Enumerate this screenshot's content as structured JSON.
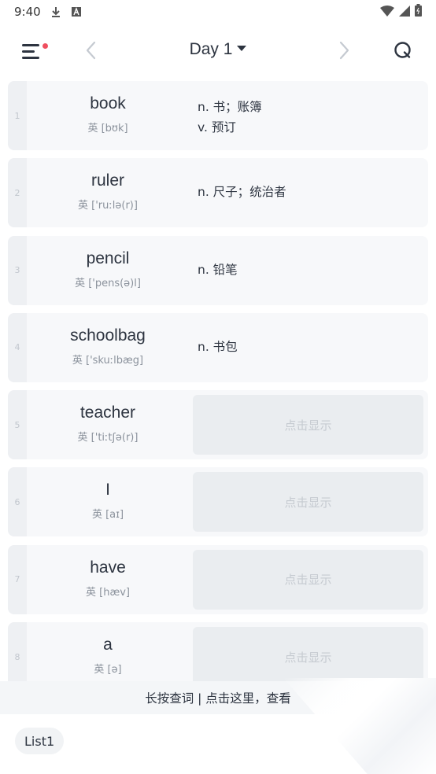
{
  "status_bar": {
    "time": "9:40"
  },
  "header": {
    "title": "Day 1"
  },
  "words": [
    {
      "index": "1",
      "word": "book",
      "phonetic": "英 [bʊk]",
      "meanings": [
        "n. 书；账簿",
        "v. 预订"
      ],
      "revealed": true
    },
    {
      "index": "2",
      "word": "ruler",
      "phonetic": "英 ['ruːlə(r)]",
      "meanings": [
        "n. 尺子；统治者"
      ],
      "revealed": true
    },
    {
      "index": "3",
      "word": "pencil",
      "phonetic": "英 ['pens(ə)l]",
      "meanings": [
        "n. 铅笔"
      ],
      "revealed": true
    },
    {
      "index": "4",
      "word": "schoolbag",
      "phonetic": "英 ['skuːlbæg]",
      "meanings": [
        "n. 书包"
      ],
      "revealed": true
    },
    {
      "index": "5",
      "word": "teacher",
      "phonetic": "英 ['tiːtʃə(r)]",
      "reveal_label": "点击显示",
      "revealed": false
    },
    {
      "index": "6",
      "word": "I",
      "phonetic": "英 [aɪ]",
      "reveal_label": "点击显示",
      "revealed": false
    },
    {
      "index": "7",
      "word": "have",
      "phonetic": "英 [hæv]",
      "reveal_label": "点击显示",
      "revealed": false
    },
    {
      "index": "8",
      "word": "a",
      "phonetic": "英 [ə]",
      "reveal_label": "点击显示",
      "revealed": false
    }
  ],
  "hint_bar": {
    "text": "长按查词 | 点击这里，查看"
  },
  "list_chip": {
    "label": "List1"
  },
  "colors": {
    "accent_dot": "#ef4f5f",
    "card_bg": "#f7f8fa",
    "reveal_bg": "#eaedf0"
  },
  "icons": [
    "menu-icon",
    "chevron-left-icon",
    "caret-down-icon",
    "chevron-right-icon",
    "search-icon",
    "download-icon",
    "font-icon",
    "wifi-icon",
    "signal-icon",
    "battery-icon"
  ]
}
